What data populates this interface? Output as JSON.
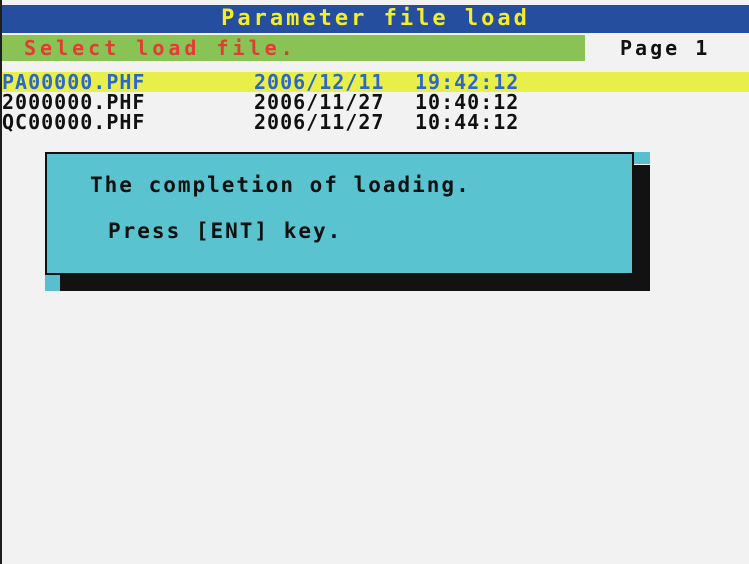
{
  "window": {
    "title": "Parameter file load"
  },
  "status": {
    "message": "Select load file.",
    "page": "Page 1"
  },
  "files": [
    {
      "name": "PA00000.PHF",
      "date": "2006/12/11",
      "time": "19:42:12",
      "selected": true
    },
    {
      "name": "2000000.PHF",
      "date": "2006/11/27",
      "time": "10:40:12",
      "selected": false
    },
    {
      "name": "QC00000.PHF",
      "date": "2006/11/27",
      "time": "10:44:12",
      "selected": false
    }
  ],
  "dialog": {
    "line1": "The completion of loading.",
    "line2": "Press [ENT] key."
  },
  "colors": {
    "title_bg": "#264e9f",
    "title_text": "#f4ee2a",
    "status_bg": "#89c255",
    "status_text": "#e43b32",
    "selected_row_bg": "#e8ef4a",
    "selected_row_text": "#2d68c9",
    "dialog_bg": "#59c4cf"
  }
}
